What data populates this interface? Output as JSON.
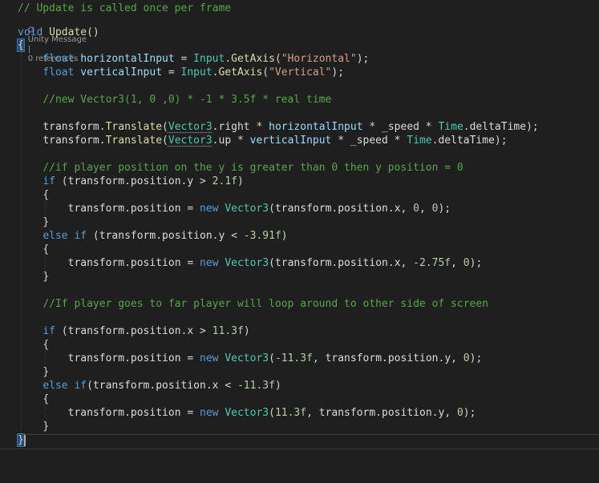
{
  "codelens": {
    "unity_message": "Unity Message",
    "separator": "|",
    "references": "0 references"
  },
  "lines": [
    {
      "tokens": [
        {
          "t": "// Update is called once per frame",
          "c": "cm"
        }
      ]
    },
    {
      "tokens": [
        {
          "t": "void",
          "c": "kw"
        },
        {
          "t": " ",
          "c": "pu"
        },
        {
          "t": "Update",
          "c": "fn"
        },
        {
          "t": "()",
          "c": "pu"
        }
      ]
    },
    {
      "tokens": [
        {
          "t": "{",
          "c": "pu",
          "hl": true
        }
      ]
    },
    {
      "tokens": [
        {
          "t": "    "
        },
        {
          "t": "float",
          "c": "kw"
        },
        {
          "t": " "
        },
        {
          "t": "horizontalInput",
          "c": "pr"
        },
        {
          "t": " = "
        },
        {
          "t": "Input",
          "c": "ty"
        },
        {
          "t": "."
        },
        {
          "t": "GetAxis",
          "c": "fn"
        },
        {
          "t": "("
        },
        {
          "t": "\"Horizontal\"",
          "c": "st"
        },
        {
          "t": ");"
        }
      ]
    },
    {
      "tokens": [
        {
          "t": "    "
        },
        {
          "t": "float",
          "c": "kw"
        },
        {
          "t": " "
        },
        {
          "t": "verticalInput",
          "c": "pr"
        },
        {
          "t": " = "
        },
        {
          "t": "Input",
          "c": "ty"
        },
        {
          "t": "."
        },
        {
          "t": "GetAxis",
          "c": "fn"
        },
        {
          "t": "("
        },
        {
          "t": "\"Vertical\"",
          "c": "st"
        },
        {
          "t": ");"
        }
      ]
    },
    {
      "tokens": []
    },
    {
      "tokens": [
        {
          "t": "    "
        },
        {
          "t": "//new Vector3(1, 0 ,0) * -1 * 3.5f * real time",
          "c": "cm"
        }
      ]
    },
    {
      "tokens": []
    },
    {
      "tokens": [
        {
          "t": "    "
        },
        {
          "t": "transform",
          "c": "id"
        },
        {
          "t": "."
        },
        {
          "t": "Translate",
          "c": "fn"
        },
        {
          "t": "("
        },
        {
          "t": "Vector3",
          "c": "ty",
          "sq": true
        },
        {
          "t": "."
        },
        {
          "t": "right",
          "c": "id"
        },
        {
          "t": " * "
        },
        {
          "t": "horizontalInput",
          "c": "pr"
        },
        {
          "t": " * "
        },
        {
          "t": "_speed",
          "c": "id"
        },
        {
          "t": " * "
        },
        {
          "t": "Time",
          "c": "ty"
        },
        {
          "t": "."
        },
        {
          "t": "deltaTime",
          "c": "id"
        },
        {
          "t": ");"
        }
      ]
    },
    {
      "tokens": [
        {
          "t": "    "
        },
        {
          "t": "transform",
          "c": "id"
        },
        {
          "t": "."
        },
        {
          "t": "Translate",
          "c": "fn"
        },
        {
          "t": "("
        },
        {
          "t": "Vector3",
          "c": "ty",
          "sq": true
        },
        {
          "t": "."
        },
        {
          "t": "up",
          "c": "id"
        },
        {
          "t": " * "
        },
        {
          "t": "verticalInput",
          "c": "pr"
        },
        {
          "t": " * "
        },
        {
          "t": "_speed",
          "c": "id"
        },
        {
          "t": " * "
        },
        {
          "t": "Time",
          "c": "ty"
        },
        {
          "t": "."
        },
        {
          "t": "deltaTime",
          "c": "id"
        },
        {
          "t": ");"
        }
      ]
    },
    {
      "tokens": []
    },
    {
      "tokens": [
        {
          "t": "    "
        },
        {
          "t": "//if player position on the y is greater than 0 then y position = 0",
          "c": "cm"
        }
      ]
    },
    {
      "tokens": [
        {
          "t": "    "
        },
        {
          "t": "if",
          "c": "kw"
        },
        {
          "t": " ("
        },
        {
          "t": "transform",
          "c": "id"
        },
        {
          "t": "."
        },
        {
          "t": "position",
          "c": "id"
        },
        {
          "t": "."
        },
        {
          "t": "y",
          "c": "id"
        },
        {
          "t": " > "
        },
        {
          "t": "2.1f",
          "c": "nm"
        },
        {
          "t": ")"
        }
      ]
    },
    {
      "tokens": [
        {
          "t": "    "
        },
        {
          "t": "{"
        }
      ]
    },
    {
      "tokens": [
        {
          "t": "        "
        },
        {
          "t": "transform",
          "c": "id"
        },
        {
          "t": "."
        },
        {
          "t": "position",
          "c": "id"
        },
        {
          "t": " = "
        },
        {
          "t": "new",
          "c": "kw"
        },
        {
          "t": " "
        },
        {
          "t": "Vector3",
          "c": "ty"
        },
        {
          "t": "("
        },
        {
          "t": "transform",
          "c": "id"
        },
        {
          "t": "."
        },
        {
          "t": "position",
          "c": "id"
        },
        {
          "t": "."
        },
        {
          "t": "x",
          "c": "id"
        },
        {
          "t": ", "
        },
        {
          "t": "0",
          "c": "nm"
        },
        {
          "t": ", "
        },
        {
          "t": "0",
          "c": "nm"
        },
        {
          "t": ");"
        }
      ]
    },
    {
      "tokens": [
        {
          "t": "    "
        },
        {
          "t": "}"
        }
      ]
    },
    {
      "tokens": [
        {
          "t": "    "
        },
        {
          "t": "else",
          "c": "kw"
        },
        {
          "t": " "
        },
        {
          "t": "if",
          "c": "kw"
        },
        {
          "t": " ("
        },
        {
          "t": "transform",
          "c": "id"
        },
        {
          "t": "."
        },
        {
          "t": "position",
          "c": "id"
        },
        {
          "t": "."
        },
        {
          "t": "y",
          "c": "id"
        },
        {
          "t": " < "
        },
        {
          "t": "-3.91f",
          "c": "nm"
        },
        {
          "t": ")"
        }
      ]
    },
    {
      "tokens": [
        {
          "t": "    "
        },
        {
          "t": "{"
        }
      ]
    },
    {
      "tokens": [
        {
          "t": "        "
        },
        {
          "t": "transform",
          "c": "id"
        },
        {
          "t": "."
        },
        {
          "t": "position",
          "c": "id"
        },
        {
          "t": " = "
        },
        {
          "t": "new",
          "c": "kw"
        },
        {
          "t": " "
        },
        {
          "t": "Vector3",
          "c": "ty"
        },
        {
          "t": "("
        },
        {
          "t": "transform",
          "c": "id"
        },
        {
          "t": "."
        },
        {
          "t": "position",
          "c": "id"
        },
        {
          "t": "."
        },
        {
          "t": "x",
          "c": "id"
        },
        {
          "t": ", "
        },
        {
          "t": "-2.75f",
          "c": "nm"
        },
        {
          "t": ", "
        },
        {
          "t": "0",
          "c": "nm"
        },
        {
          "t": ");"
        }
      ]
    },
    {
      "tokens": [
        {
          "t": "    "
        },
        {
          "t": "}"
        }
      ]
    },
    {
      "tokens": []
    },
    {
      "tokens": [
        {
          "t": "    "
        },
        {
          "t": "//If player goes to far player will loop around to other side of screen",
          "c": "cm"
        }
      ]
    },
    {
      "tokens": []
    },
    {
      "tokens": [
        {
          "t": "    "
        },
        {
          "t": "if",
          "c": "kw"
        },
        {
          "t": " ("
        },
        {
          "t": "transform",
          "c": "id"
        },
        {
          "t": "."
        },
        {
          "t": "position",
          "c": "id"
        },
        {
          "t": "."
        },
        {
          "t": "x",
          "c": "id"
        },
        {
          "t": " > "
        },
        {
          "t": "11.3f",
          "c": "nm"
        },
        {
          "t": ")"
        }
      ]
    },
    {
      "tokens": [
        {
          "t": "    "
        },
        {
          "t": "{"
        }
      ]
    },
    {
      "tokens": [
        {
          "t": "        "
        },
        {
          "t": "transform",
          "c": "id"
        },
        {
          "t": "."
        },
        {
          "t": "position",
          "c": "id"
        },
        {
          "t": " = "
        },
        {
          "t": "new",
          "c": "kw"
        },
        {
          "t": " "
        },
        {
          "t": "Vector3",
          "c": "ty"
        },
        {
          "t": "("
        },
        {
          "t": "-11.3f",
          "c": "nm"
        },
        {
          "t": ", "
        },
        {
          "t": "transform",
          "c": "id"
        },
        {
          "t": "."
        },
        {
          "t": "position",
          "c": "id"
        },
        {
          "t": "."
        },
        {
          "t": "y",
          "c": "id"
        },
        {
          "t": ", "
        },
        {
          "t": "0",
          "c": "nm"
        },
        {
          "t": ");"
        }
      ]
    },
    {
      "tokens": [
        {
          "t": "    "
        },
        {
          "t": "}"
        }
      ]
    },
    {
      "tokens": [
        {
          "t": "    "
        },
        {
          "t": "else",
          "c": "kw"
        },
        {
          "t": " "
        },
        {
          "t": "if",
          "c": "kw"
        },
        {
          "t": "("
        },
        {
          "t": "transform",
          "c": "id"
        },
        {
          "t": "."
        },
        {
          "t": "position",
          "c": "id"
        },
        {
          "t": "."
        },
        {
          "t": "x",
          "c": "id"
        },
        {
          "t": " < "
        },
        {
          "t": "-11.3f",
          "c": "nm"
        },
        {
          "t": ")"
        }
      ]
    },
    {
      "tokens": [
        {
          "t": "    "
        },
        {
          "t": "{"
        }
      ]
    },
    {
      "tokens": [
        {
          "t": "        "
        },
        {
          "t": "transform",
          "c": "id"
        },
        {
          "t": "."
        },
        {
          "t": "position",
          "c": "id"
        },
        {
          "t": " = "
        },
        {
          "t": "new",
          "c": "kw"
        },
        {
          "t": " "
        },
        {
          "t": "Vector3",
          "c": "ty"
        },
        {
          "t": "("
        },
        {
          "t": "11.3f",
          "c": "nm"
        },
        {
          "t": ", "
        },
        {
          "t": "transform",
          "c": "id"
        },
        {
          "t": "."
        },
        {
          "t": "position",
          "c": "id"
        },
        {
          "t": "."
        },
        {
          "t": "y",
          "c": "id"
        },
        {
          "t": ", "
        },
        {
          "t": "0",
          "c": "nm"
        },
        {
          "t": ");"
        }
      ]
    },
    {
      "tokens": [
        {
          "t": "    "
        },
        {
          "t": "}"
        }
      ]
    },
    {
      "tokens": [
        {
          "t": "}",
          "c": "pu",
          "hl": true
        }
      ]
    }
  ],
  "colors": {
    "background": "#1f1f1f",
    "comment": "#57a64a",
    "keyword": "#569cd6",
    "type": "#4ec9b0",
    "method": "#dcdcaa",
    "string": "#d69d85",
    "number": "#b5cea8",
    "identifier": "#dcdcdc",
    "parameter": "#9cdcfe"
  }
}
